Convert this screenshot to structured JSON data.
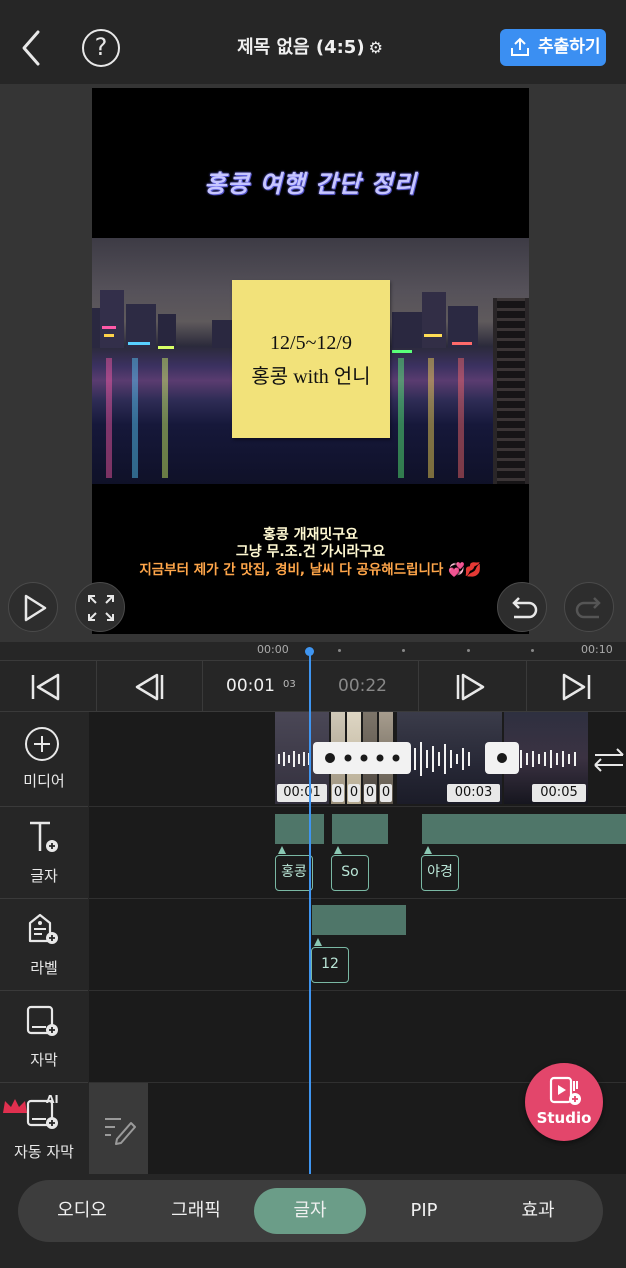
{
  "header": {
    "title": "제목 없음 (4:5)",
    "export_label": "추출하기",
    "help_glyph": "?",
    "gear_glyph": "⚙"
  },
  "preview": {
    "video_title": "홍콩 여행 간단 정리",
    "sticky_line1": "12/5~12/9",
    "sticky_line2": "홍콩 with 언니",
    "subtitle_line1": "홍콩 개재밋구요",
    "subtitle_line2": "그냥 무.조.건 가시라구요",
    "subtitle_line3": "지금부터 제가 간 맛집, 경비, 날씨 다 공유해드립니다 💞💋"
  },
  "ruler": {
    "start": "00:00",
    "end": "00:10"
  },
  "transport": {
    "current_time": "00:01",
    "current_frames": "03",
    "total_time": "00:22"
  },
  "sidebar": {
    "media": "미디어",
    "text": "글자",
    "label": "라벨",
    "caption": "자막",
    "auto_caption": "자동 자막",
    "ai_badge": "AI"
  },
  "media_clips": {
    "c1": "00:01",
    "c2": "0",
    "c3": "0",
    "c4": "0",
    "c5": "0",
    "c6": "00:03",
    "c7": "00:05"
  },
  "text_tags": {
    "t1": "홍콩",
    "t2": "So",
    "t3": "야경"
  },
  "label_tags": {
    "l1": "12"
  },
  "studio": {
    "label": "Studio"
  },
  "bottom_tabs": [
    {
      "label": "오디오"
    },
    {
      "label": "그래픽"
    },
    {
      "label": "글자"
    },
    {
      "label": "PIP"
    },
    {
      "label": "효과"
    }
  ]
}
